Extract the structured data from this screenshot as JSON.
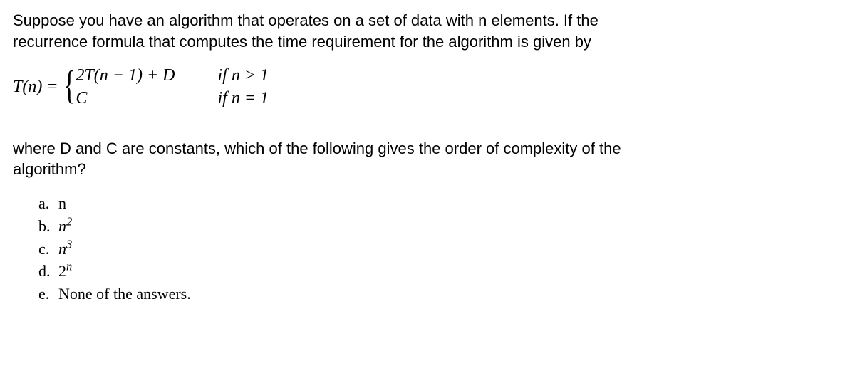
{
  "intro_line1": "Suppose you have an algorithm that operates on a set of data with n elements. If the",
  "intro_line2": "recurrence formula that computes the time requirement for the algorithm is given by",
  "formula": {
    "lhs": "T(n) = ",
    "case1_expr": "2T(n − 1) + D",
    "case2_expr": "C",
    "case1_cond": "if n > 1",
    "case2_cond": "if n = 1"
  },
  "question_line1": "where D and C are constants, which of the following gives the order of complexity of the",
  "question_line2": "algorithm?",
  "options": {
    "a": {
      "label": "a.",
      "text": "n"
    },
    "b": {
      "label": "b.",
      "base": "n",
      "sup": "2"
    },
    "c": {
      "label": "c.",
      "base": "n",
      "sup": "3"
    },
    "d": {
      "label": "d.",
      "base": "2",
      "sup": "n"
    },
    "e": {
      "label": "e.",
      "text": "None of the answers."
    }
  }
}
